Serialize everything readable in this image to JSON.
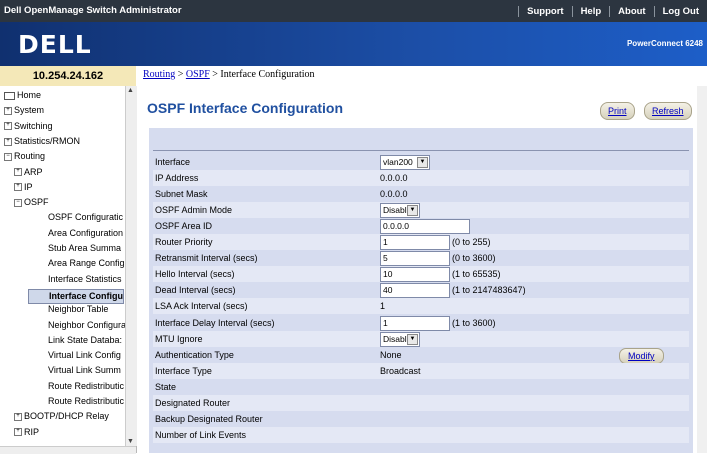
{
  "header": {
    "app_title": "Dell OpenManage Switch Administrator",
    "links": [
      "Support",
      "Help",
      "About",
      "Log Out"
    ],
    "logo": "DELL",
    "model": "PowerConnect 6248"
  },
  "ip_address": "10.254.24.162",
  "breadcrumb": {
    "item1": "Routing",
    "sep": ">",
    "item2": "OSPF",
    "current": "Interface Configuration"
  },
  "nav": {
    "items": [
      {
        "label": "Home",
        "depth": 0,
        "icon": "home-icon"
      },
      {
        "label": "System",
        "depth": 0,
        "icon": "expand-icon"
      },
      {
        "label": "Switching",
        "depth": 0,
        "icon": "expand-icon"
      },
      {
        "label": "Statistics/RMON",
        "depth": 0,
        "icon": "expand-icon"
      },
      {
        "label": "Routing",
        "depth": 0,
        "icon": "collapse-icon"
      },
      {
        "label": "ARP",
        "depth": 1,
        "icon": "expand-icon"
      },
      {
        "label": "IP",
        "depth": 1,
        "icon": "expand-icon"
      },
      {
        "label": "OSPF",
        "depth": 1,
        "icon": "collapse-icon"
      },
      {
        "label": "OSPF Configuratic",
        "depth": 2
      },
      {
        "label": "Area Configuration",
        "depth": 2
      },
      {
        "label": "Stub Area Summa",
        "depth": 2
      },
      {
        "label": "Area Range Config",
        "depth": 2
      },
      {
        "label": "Interface Statistics",
        "depth": 2
      },
      {
        "label": "Interface Configu",
        "depth": 2,
        "selected": true
      },
      {
        "label": "Neighbor Table",
        "depth": 2
      },
      {
        "label": "Neighbor Configura",
        "depth": 2
      },
      {
        "label": "Link State Databa:",
        "depth": 2
      },
      {
        "label": "Virtual Link Config",
        "depth": 2
      },
      {
        "label": "Virtual Link Summ",
        "depth": 2
      },
      {
        "label": "Route Redistributic",
        "depth": 2
      },
      {
        "label": "Route Redistributic",
        "depth": 2
      },
      {
        "label": "BOOTP/DHCP Relay",
        "depth": 1,
        "icon": "expand-icon"
      },
      {
        "label": "RIP",
        "depth": 1,
        "icon": "expand-icon"
      }
    ]
  },
  "page": {
    "title": "OSPF Interface Configuration",
    "print_label": "Print",
    "refresh_label": "Refresh",
    "modify_label": "Modify"
  },
  "form": {
    "rows": [
      {
        "label": "Interface",
        "type": "select",
        "value": "vlan200"
      },
      {
        "label": "IP Address",
        "type": "text",
        "value": "0.0.0.0"
      },
      {
        "label": "Subnet Mask",
        "type": "text",
        "value": "0.0.0.0"
      },
      {
        "label": "OSPF Admin Mode",
        "type": "select",
        "value": "Disable"
      },
      {
        "label": "OSPF Area ID",
        "type": "input",
        "value": "0.0.0.0"
      },
      {
        "label": "Router Priority",
        "type": "input",
        "value": "1",
        "hint": "(0 to 255)"
      },
      {
        "label": "Retransmit Interval (secs)",
        "type": "input",
        "value": "5",
        "hint": "(0 to 3600)"
      },
      {
        "label": "Hello Interval (secs)",
        "type": "input",
        "value": "10",
        "hint": "(1 to 65535)"
      },
      {
        "label": "Dead Interval (secs)",
        "type": "input",
        "value": "40",
        "hint": "(1 to 2147483647)"
      },
      {
        "label": "LSA Ack Interval (secs)",
        "type": "text",
        "value": "1"
      },
      {
        "label": "Interface Delay Interval (secs)",
        "type": "input",
        "value": "1",
        "hint": "(1 to 3600)"
      },
      {
        "label": "MTU Ignore",
        "type": "select",
        "value": "Disable"
      },
      {
        "label": "Authentication Type",
        "type": "text",
        "value": "None",
        "button": "Modify"
      },
      {
        "label": "Interface Type",
        "type": "text",
        "value": "Broadcast"
      },
      {
        "label": "State",
        "type": "text",
        "value": ""
      },
      {
        "label": "Designated Router",
        "type": "text",
        "value": ""
      },
      {
        "label": "Backup Designated Router",
        "type": "text",
        "value": ""
      },
      {
        "label": "Number of Link Events",
        "type": "text",
        "value": ""
      }
    ]
  }
}
